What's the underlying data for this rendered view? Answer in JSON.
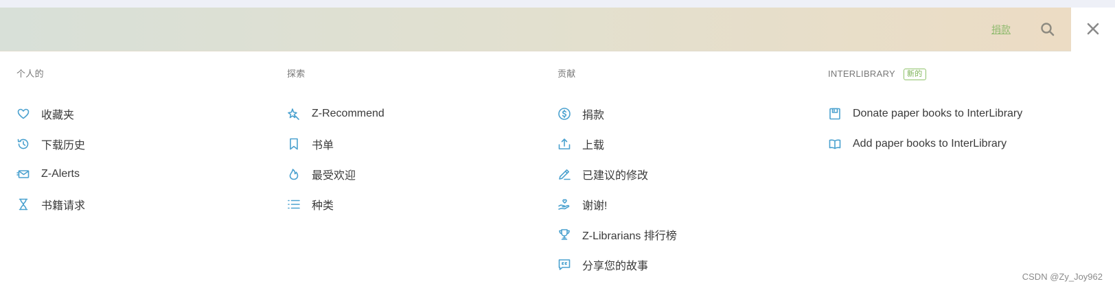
{
  "header": {
    "donate_label": "捐款"
  },
  "columns": {
    "personal": {
      "title": "个人的",
      "items": [
        {
          "label": "收藏夹",
          "icon": "heart-icon"
        },
        {
          "label": "下载历史",
          "icon": "history-icon"
        },
        {
          "label": "Z-Alerts",
          "icon": "mail-alert-icon"
        },
        {
          "label": "书籍请求",
          "icon": "hourglass-icon"
        }
      ]
    },
    "explore": {
      "title": "探索",
      "items": [
        {
          "label": "Z-Recommend",
          "icon": "sparkle-pin-icon"
        },
        {
          "label": "书单",
          "icon": "bookmark-icon"
        },
        {
          "label": "最受欢迎",
          "icon": "flame-icon"
        },
        {
          "label": "种类",
          "icon": "list-icon"
        }
      ]
    },
    "contribute": {
      "title": "贡献",
      "items": [
        {
          "label": "捐款",
          "icon": "dollar-circle-icon"
        },
        {
          "label": "上载",
          "icon": "upload-icon"
        },
        {
          "label": "已建议的修改",
          "icon": "pencil-icon"
        },
        {
          "label": "谢谢!",
          "icon": "hand-heart-icon"
        },
        {
          "label": "Z-Librarians 排行榜",
          "icon": "trophy-icon"
        },
        {
          "label": "分享您的故事",
          "icon": "quote-bubble-icon"
        }
      ]
    },
    "interlibrary": {
      "title": "INTERLIBRARY",
      "badge": "新的",
      "items": [
        {
          "label": "Donate paper books to InterLibrary",
          "icon": "save-box-icon"
        },
        {
          "label": "Add paper books to InterLibrary",
          "icon": "open-book-icon"
        }
      ]
    }
  },
  "watermark": "CSDN @Zy_Joy962",
  "colors": {
    "accent": "#4aa1cf",
    "donate": "#8fba6e",
    "badge": "#7bb255",
    "text": "#3a3a3a"
  }
}
